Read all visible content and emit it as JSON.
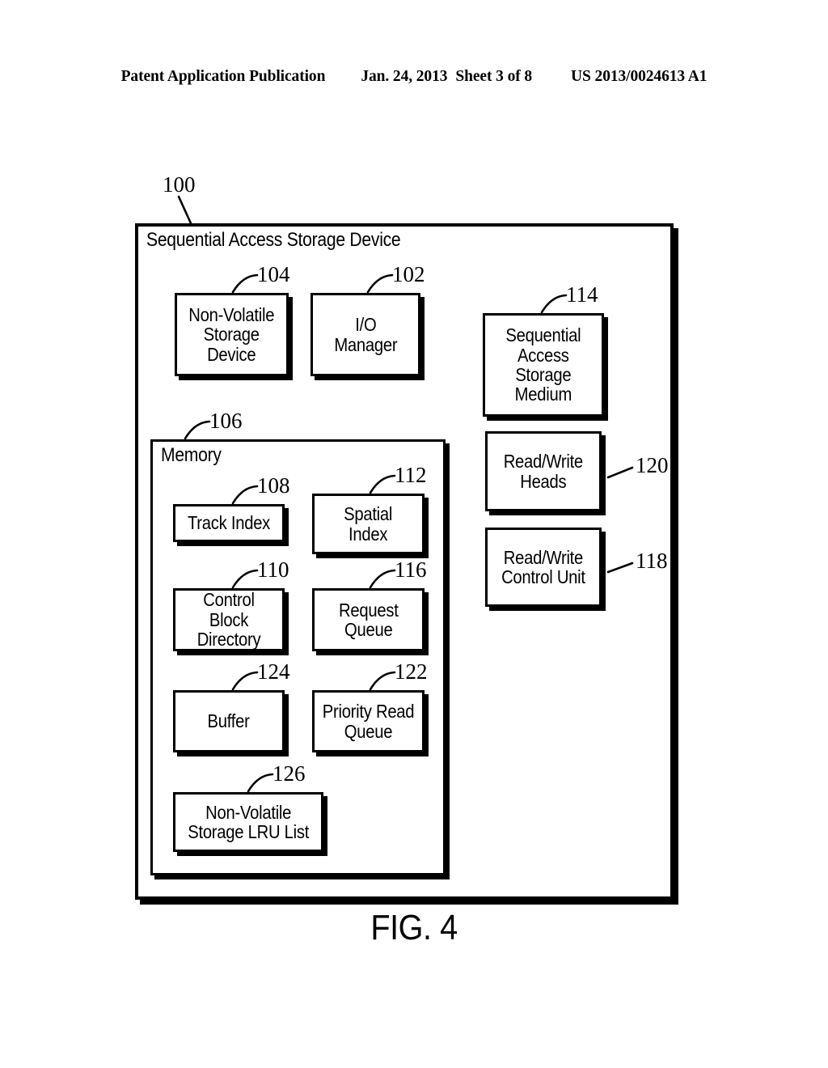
{
  "header": {
    "left": "Patent Application Publication",
    "date": "Jan. 24, 2013",
    "sheet": "Sheet 3 of 8",
    "patent_number": "US 2013/0024613 A1"
  },
  "figure": {
    "caption": "FIG. 4"
  },
  "diagram": {
    "outer": {
      "title": "Sequential Access Storage Device",
      "ref": "100"
    },
    "memory": {
      "title": "Memory",
      "ref": "106"
    },
    "blocks": {
      "non_volatile_storage_device": {
        "label": "Non-Volatile\nStorage\nDevice",
        "ref": "104"
      },
      "io_manager": {
        "label": "I/O\nManager",
        "ref": "102"
      },
      "sequential_access_storage_medium": {
        "label": "Sequential\nAccess\nStorage\nMedium",
        "ref": "114"
      },
      "read_write_heads": {
        "label": "Read/Write\nHeads",
        "ref": "120"
      },
      "read_write_control_unit": {
        "label": "Read/Write\nControl Unit",
        "ref": "118"
      },
      "track_index": {
        "label": "Track Index",
        "ref": "108"
      },
      "spatial_index": {
        "label": "Spatial\nIndex",
        "ref": "112"
      },
      "control_block_directory": {
        "label": "Control Block\nDirectory",
        "ref": "110"
      },
      "request_queue": {
        "label": "Request\nQueue",
        "ref": "116"
      },
      "buffer": {
        "label": "Buffer",
        "ref": "124"
      },
      "priority_read_queue": {
        "label": "Priority Read\nQueue",
        "ref": "122"
      },
      "non_volatile_storage_lru_list": {
        "label": "Non-Volatile\nStorage LRU List",
        "ref": "126"
      }
    }
  },
  "colors": {
    "ink": "#000000",
    "paper": "#ffffff"
  }
}
